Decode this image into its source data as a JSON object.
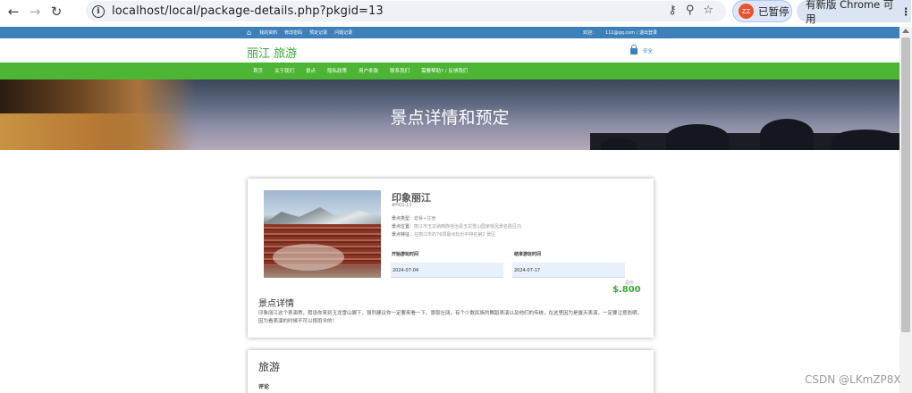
{
  "browser": {
    "url": "localhost/local/package-details.php?pkgid=13",
    "profile_initials": "ZZ",
    "profile_status": "已暂停",
    "update_label": "有新版 Chrome 可用",
    "update_more": "⋮"
  },
  "site": {
    "topbar_links": [
      "我的资料",
      "修改密码",
      "预定记录",
      "问题记录"
    ],
    "welcome": "欢迎：",
    "user_email": "111@qq.com / 退出登录",
    "brand_main": "丽江",
    "brand_sub": "旅游",
    "secure_label": "安全",
    "nav_items": [
      "首页",
      "关于我们",
      "景点",
      "隐私政策",
      "用户条款",
      "联系我们",
      "需要帮助? / 反馈我们"
    ],
    "banner_title": "景点详情和预定"
  },
  "package": {
    "name": "印象丽江",
    "code": "#PKG-13",
    "type_label": "景点类型：",
    "type_value": "套餐+住宿",
    "location_label": "景点位置：",
    "location_value": "丽江市玉龙纳西族自治县玉龙雪山国家级风景名胜区内",
    "feature_label": "景点特征：",
    "feature_value": "在丽江市的76项最点玩乐中排名第2 景区",
    "start_label": "开始游玩时间",
    "start_date": "2024-07-04",
    "end_label": "结束游玩时间",
    "end_date": "2024-07-17",
    "price_label": "总价",
    "price": "$.800",
    "details_heading": "景点详情",
    "details_text": "印象丽江这个表演秀，假设你来到玉龙雪山脚下，强烈建议你一定要来看一下。景取壮阔，有个少数民族的舞蹈表演以及他们的传统，在这里因为是露天表演，一定要注意防晒，因为看表演的时候不可以撑雨伞的！"
  },
  "section2": {
    "heading": "旅游",
    "comment_label": "评论"
  },
  "watermark": "CSDN @LKmZP8X"
}
